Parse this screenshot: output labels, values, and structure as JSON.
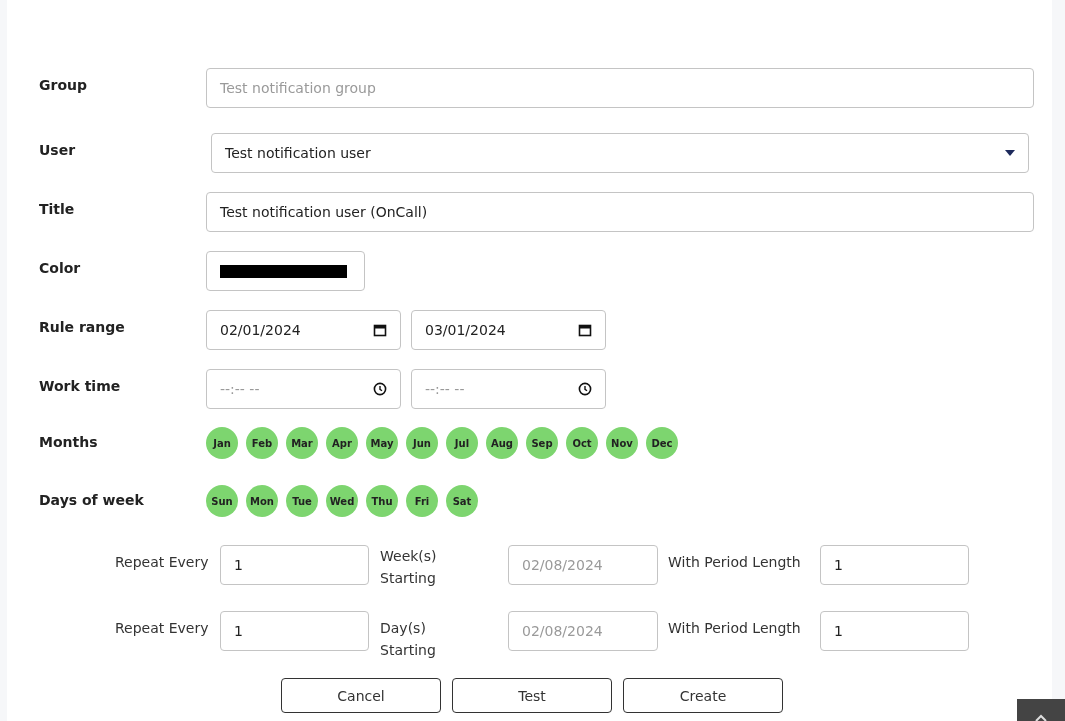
{
  "form": {
    "group": {
      "label": "Group",
      "placeholder": "Test notification group"
    },
    "user": {
      "label": "User",
      "value": "Test notification user"
    },
    "title": {
      "label": "Title",
      "value": "Test notification user (OnCall)"
    },
    "color": {
      "label": "Color",
      "color": "#000000"
    },
    "rule_range": {
      "label": "Rule range",
      "start": "02/01/2024",
      "end": "03/01/2024"
    },
    "work_time": {
      "label": "Work time",
      "start_placeholder": "--:-- --",
      "end_placeholder": "--:-- --"
    },
    "months": {
      "label": "Months",
      "items": [
        {
          "label": "Jan",
          "selected": true
        },
        {
          "label": "Feb",
          "selected": true
        },
        {
          "label": "Mar",
          "selected": true
        },
        {
          "label": "Apr",
          "selected": true
        },
        {
          "label": "May",
          "selected": true
        },
        {
          "label": "Jun",
          "selected": true
        },
        {
          "label": "Jul",
          "selected": true
        },
        {
          "label": "Aug",
          "selected": true
        },
        {
          "label": "Sep",
          "selected": true
        },
        {
          "label": "Oct",
          "selected": true
        },
        {
          "label": "Nov",
          "selected": true
        },
        {
          "label": "Dec",
          "selected": true
        }
      ]
    },
    "days": {
      "label": "Days of week",
      "items": [
        {
          "label": "Sun",
          "selected": true
        },
        {
          "label": "Mon",
          "selected": true
        },
        {
          "label": "Tue",
          "selected": true
        },
        {
          "label": "Wed",
          "selected": true
        },
        {
          "label": "Thu",
          "selected": true
        },
        {
          "label": "Fri",
          "selected": true
        },
        {
          "label": "Sat",
          "selected": true
        }
      ]
    },
    "repeats": [
      {
        "repeat_label": "Repeat Every",
        "repeat_value": "1",
        "unit_label": "Week(s) Starting",
        "start_date": "02/08/2024",
        "start_disabled": true,
        "period_label": "With Period Length",
        "period_value": "1"
      },
      {
        "repeat_label": "Repeat Every",
        "repeat_value": "1",
        "unit_label": "Day(s) Starting",
        "start_date": "02/08/2024",
        "start_disabled": true,
        "period_label": "With Period Length",
        "period_value": "1"
      }
    ],
    "buttons": [
      "Cancel",
      "Test",
      "Create"
    ]
  }
}
